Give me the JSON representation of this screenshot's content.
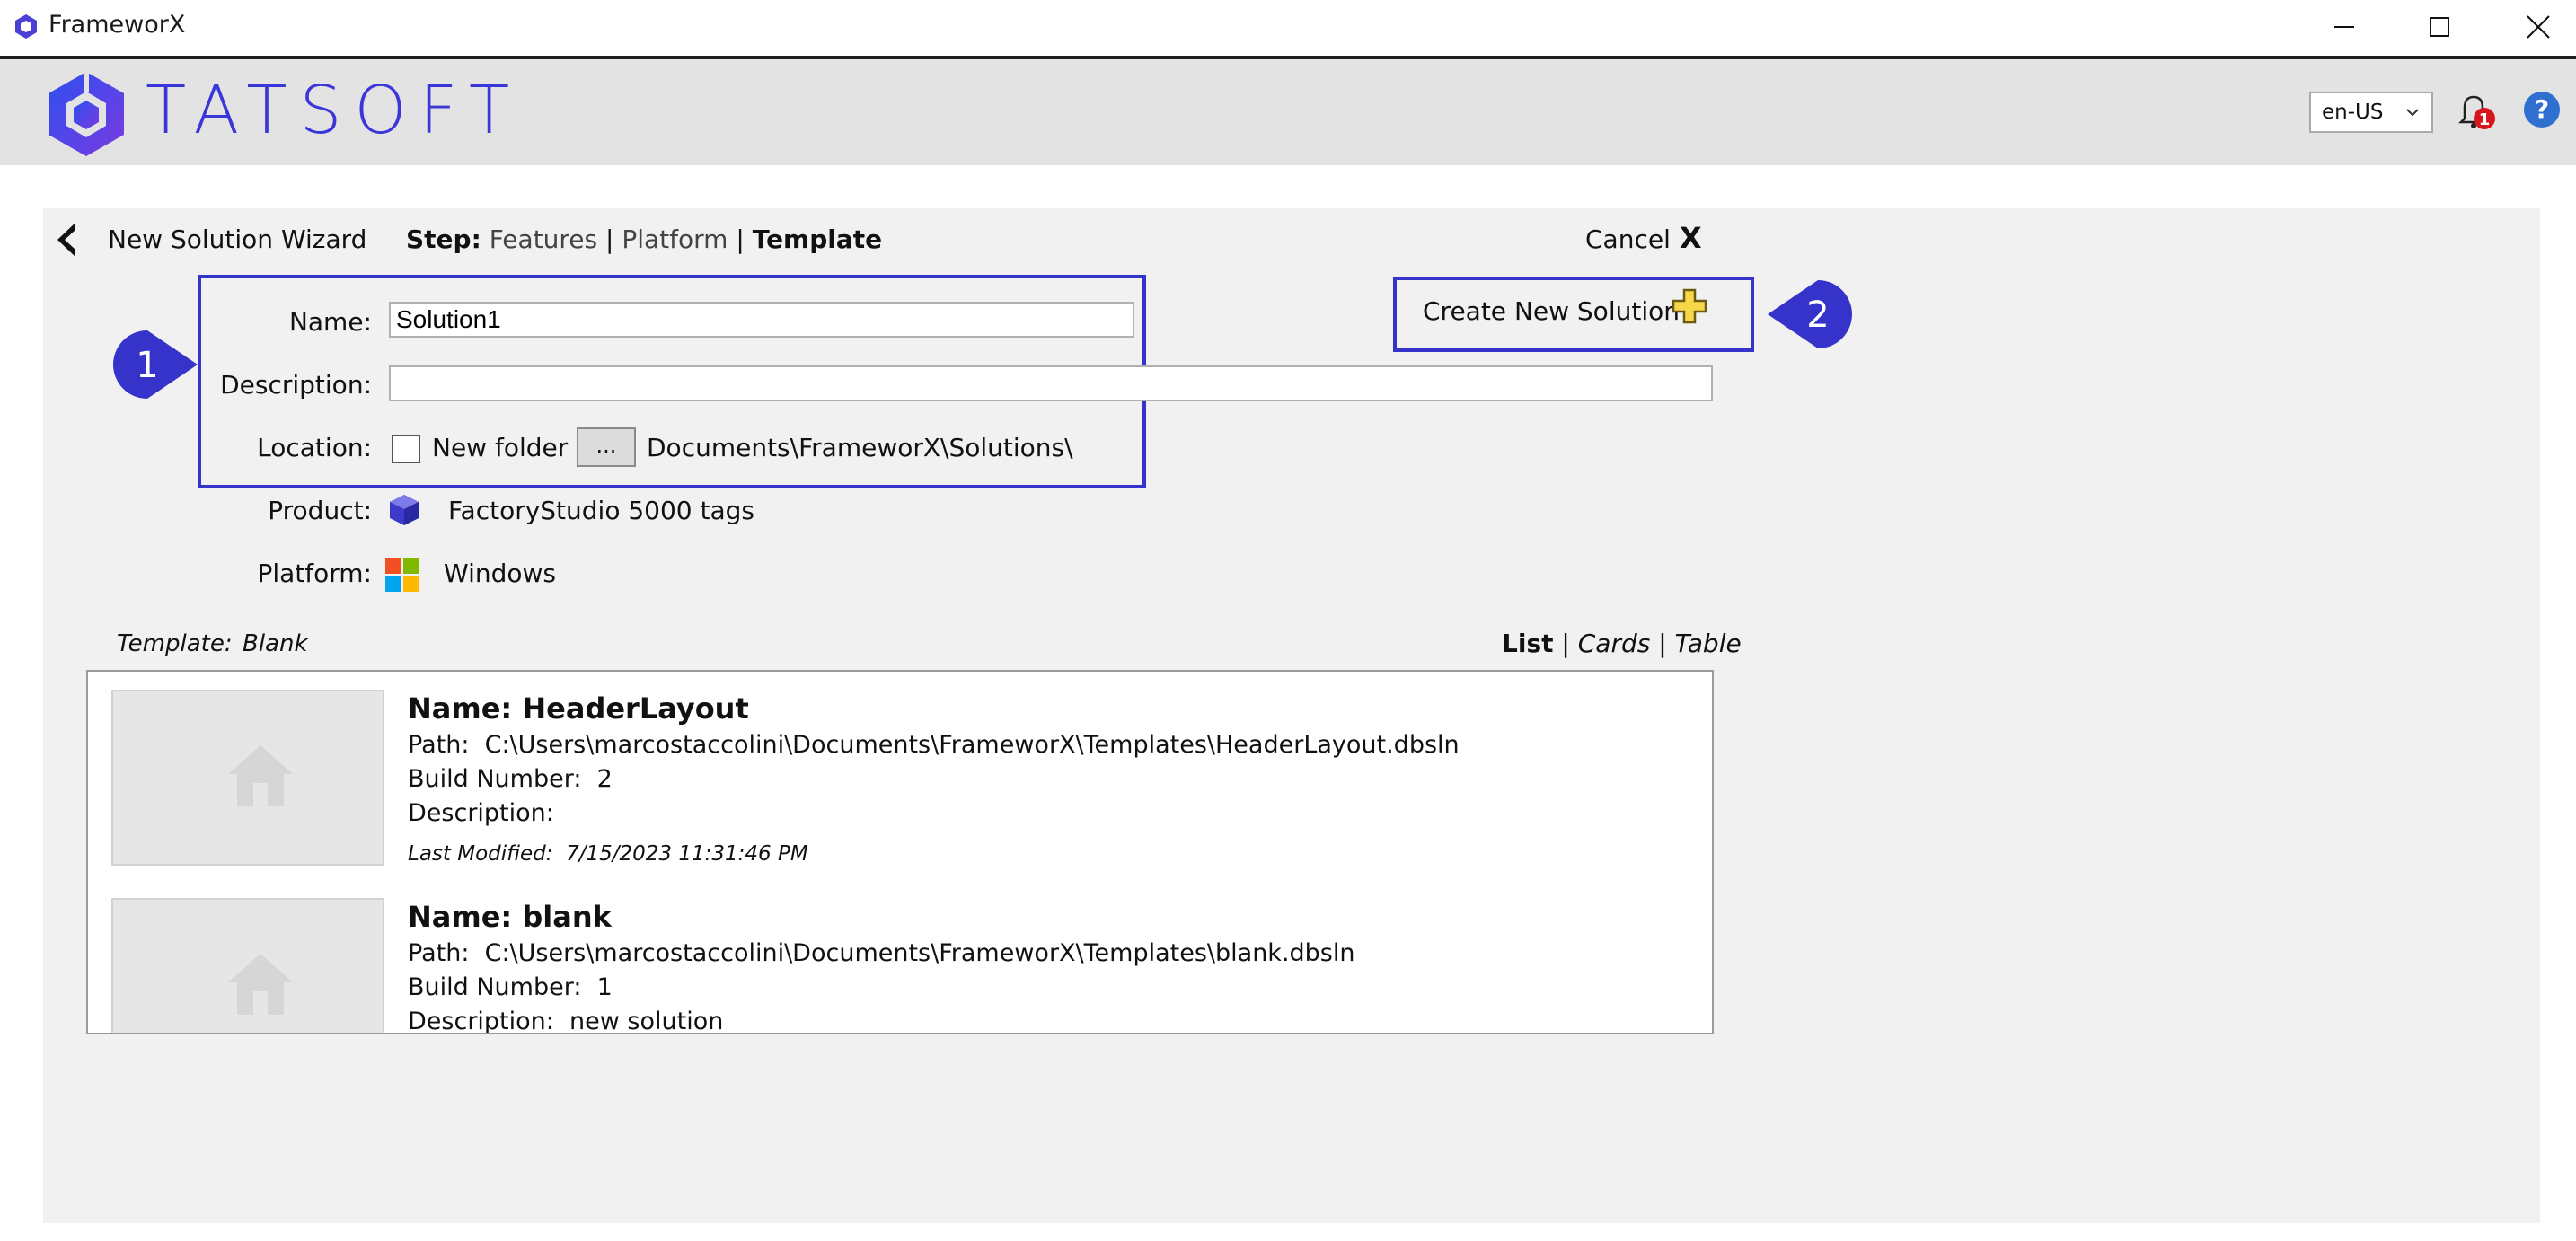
{
  "window": {
    "title": "FrameworX"
  },
  "header": {
    "brand": "TATSOFT",
    "language": "en-US",
    "notification_count": "1"
  },
  "wizard": {
    "title": "New Solution Wizard",
    "step_label": "Step:",
    "steps": [
      "Features",
      "Platform",
      "Template"
    ],
    "separator": "|",
    "cancel_label": "Cancel",
    "cancel_x": "X",
    "create_label": "Create New Solution",
    "callouts": [
      "1",
      "2"
    ]
  },
  "form": {
    "name_label": "Name:",
    "name_value": "Solution1",
    "description_label": "Description:",
    "description_value": "",
    "location_label": "Location:",
    "new_folder_label": "New folder",
    "browse_label": "...",
    "location_path": "Documents\\FrameworX\\Solutions\\",
    "product_label": "Product:",
    "product_value": "FactoryStudio 5000 tags",
    "platform_label": "Platform:",
    "platform_value": "Windows"
  },
  "templates": {
    "label": "Template:",
    "selected": "Blank",
    "views": [
      "List",
      "Cards",
      "Table"
    ],
    "items": [
      {
        "name": "Name: HeaderLayout",
        "path_label": "Path:",
        "path": "C:\\Users\\marcostaccolini\\Documents\\FrameworX\\Templates\\HeaderLayout.dbsln",
        "build_label": "Build Number:",
        "build": "2",
        "description_label": "Description:",
        "description": "",
        "modified_label": "Last Modified:",
        "modified": "7/15/2023 11:31:46 PM"
      },
      {
        "name": "Name: blank",
        "path_label": "Path:",
        "path": "C:\\Users\\marcostaccolini\\Documents\\FrameworX\\Templates\\blank.dbsln",
        "build_label": "Build Number:",
        "build": "1",
        "description_label": "Description:",
        "description": "new solution"
      }
    ]
  },
  "colors": {
    "accent": "#3533c9",
    "brand": "#3a36d8",
    "panel": "#f1f1f1",
    "header": "#e3e3e3"
  }
}
